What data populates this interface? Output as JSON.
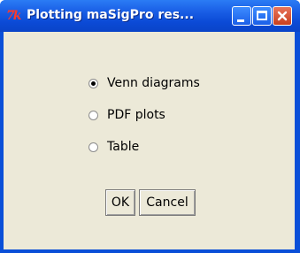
{
  "window": {
    "title": "Plotting maSigPro res...",
    "app_icon": "tk-icon",
    "controls": [
      "minimize-icon",
      "maximize-icon",
      "close-icon"
    ]
  },
  "options": [
    {
      "label": "Venn diagrams",
      "selected": true
    },
    {
      "label": "PDF plots",
      "selected": false
    },
    {
      "label": "Table",
      "selected": false
    }
  ],
  "buttons": {
    "ok": "OK",
    "cancel": "Cancel"
  }
}
